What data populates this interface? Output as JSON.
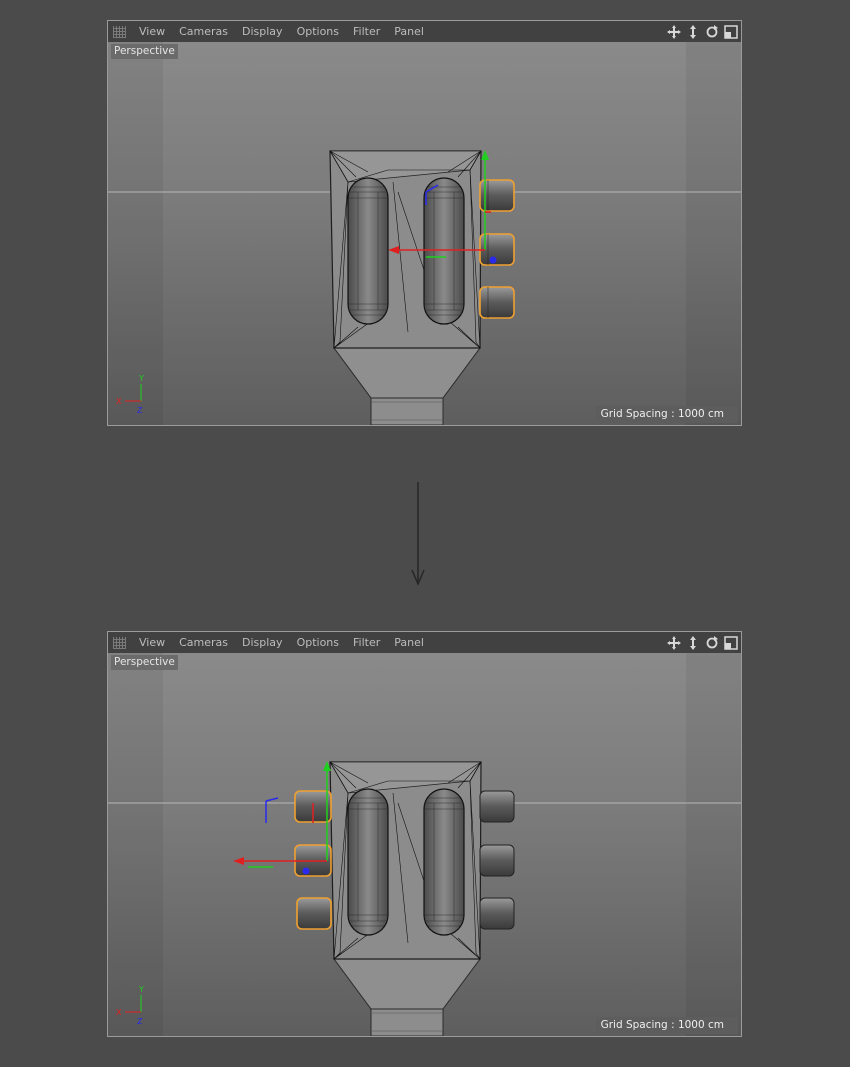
{
  "menu": [
    "View",
    "Cameras",
    "Display",
    "Options",
    "Filter",
    "Panel"
  ],
  "nav_icons": [
    "move-view-icon",
    "dolly-view-icon",
    "rotate-view-icon",
    "toggle-view-icon"
  ],
  "viewport_top": {
    "view_label": "Perspective",
    "grid_spacing": "Grid Spacing : 1000 cm",
    "axis_labels": {
      "x": "X",
      "y": "Y",
      "z": "Z"
    }
  },
  "viewport_bottom": {
    "view_label": "Perspective",
    "grid_spacing": "Grid Spacing : 1000 cm",
    "axis_labels": {
      "x": "X",
      "y": "Y",
      "z": "Z"
    }
  },
  "colors": {
    "selection": "#f0a030",
    "axis_x": "#e02020",
    "axis_y": "#20d020",
    "axis_z": "#2a2aee"
  }
}
